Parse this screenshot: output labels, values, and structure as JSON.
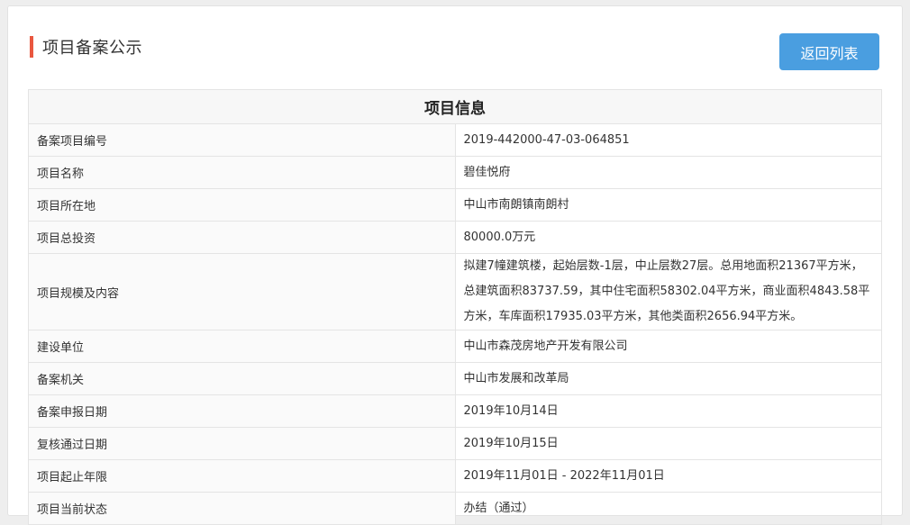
{
  "page": {
    "title": "项目备案公示",
    "back_button": "返回列表"
  },
  "table": {
    "header": "项目信息",
    "rows": [
      {
        "label": "备案项目编号",
        "value": "2019-442000-47-03-064851"
      },
      {
        "label": "项目名称",
        "value": "碧佳悦府"
      },
      {
        "label": "项目所在地",
        "value": "中山市南朗镇南朗村"
      },
      {
        "label": "项目总投资",
        "value": "80000.0万元"
      },
      {
        "label": "项目规模及内容",
        "value": "拟建7幢建筑楼，起始层数-1层，中止层数27层。总用地面积21367平方米，总建筑面积83737.59，其中住宅面积58302.04平方米，商业面积4843.58平方米，车库面积17935.03平方米，其他类面积2656.94平方米。"
      },
      {
        "label": "建设单位",
        "value": "中山市森茂房地产开发有限公司"
      },
      {
        "label": "备案机关",
        "value": "中山市发展和改革局"
      },
      {
        "label": "备案申报日期",
        "value": "2019年10月14日"
      },
      {
        "label": "复核通过日期",
        "value": "2019年10月15日"
      },
      {
        "label": "项目起止年限",
        "value": "2019年11月01日 - 2022年11月01日"
      },
      {
        "label": "项目当前状态",
        "value": "办结（通过）"
      }
    ]
  }
}
